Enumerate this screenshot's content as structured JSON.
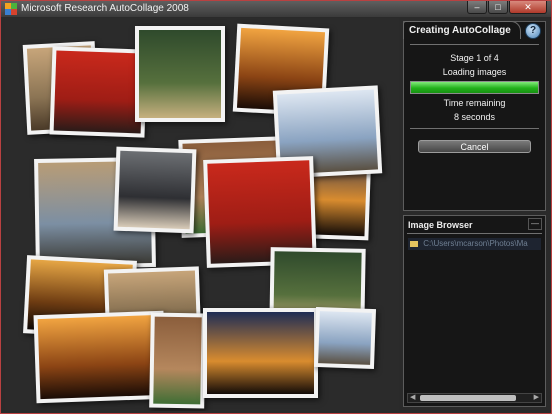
{
  "window": {
    "title": "Microsoft Research AutoCollage 2008",
    "controls": {
      "minimize": "–",
      "maximize": "□",
      "close": "✕"
    }
  },
  "progress_panel": {
    "tab_title": "Creating AutoCollage",
    "help_icon": "?",
    "stage": "Stage 1 of 4",
    "status": "Loading images",
    "progress_fraction": 1.0,
    "time_label": "Time remaining",
    "time_value": "8 seconds",
    "cancel_label": "Cancel"
  },
  "image_browser": {
    "title": "Image Browser",
    "close_label": "—",
    "path": "C:\\Users\\mcarson\\Photos\\Ma"
  },
  "collage_photos": [
    {
      "name": "desert-mountains-photo",
      "colors": [
        "#c7a57a",
        "#8b7454",
        "#4a3a28"
      ]
    },
    {
      "name": "red-jersey-photo",
      "colors": [
        "#c9291c",
        "#9f1d15",
        "#2b1b18"
      ]
    },
    {
      "name": "woman-hat-photo",
      "colors": [
        "#2f4a2c",
        "#56703d",
        "#c6b07f"
      ]
    },
    {
      "name": "sunset-minaret-photo",
      "colors": [
        "#f1a441",
        "#8b4414",
        "#1a0c06"
      ]
    },
    {
      "name": "courtyard-plants-photo",
      "colors": [
        "#8b5e3c",
        "#b5875d",
        "#3f6e35"
      ]
    },
    {
      "name": "city-night-photo",
      "colors": [
        "#1f2d55",
        "#d98c2f",
        "#120b08"
      ]
    },
    {
      "name": "snowy-mountains-photo",
      "colors": [
        "#dde6f1",
        "#8aa3c1",
        "#5a5042"
      ]
    },
    {
      "name": "market-street-photo",
      "colors": [
        "#b89c76",
        "#7c8fa3",
        "#3b3a35"
      ]
    },
    {
      "name": "woman-portrait-photo",
      "colors": [
        "#6c6f73",
        "#2e2f33",
        "#d8cbb8"
      ]
    },
    {
      "name": "minaret-dusk-photo",
      "colors": [
        "#e6a645",
        "#6e3c12",
        "#0e0805"
      ]
    }
  ]
}
